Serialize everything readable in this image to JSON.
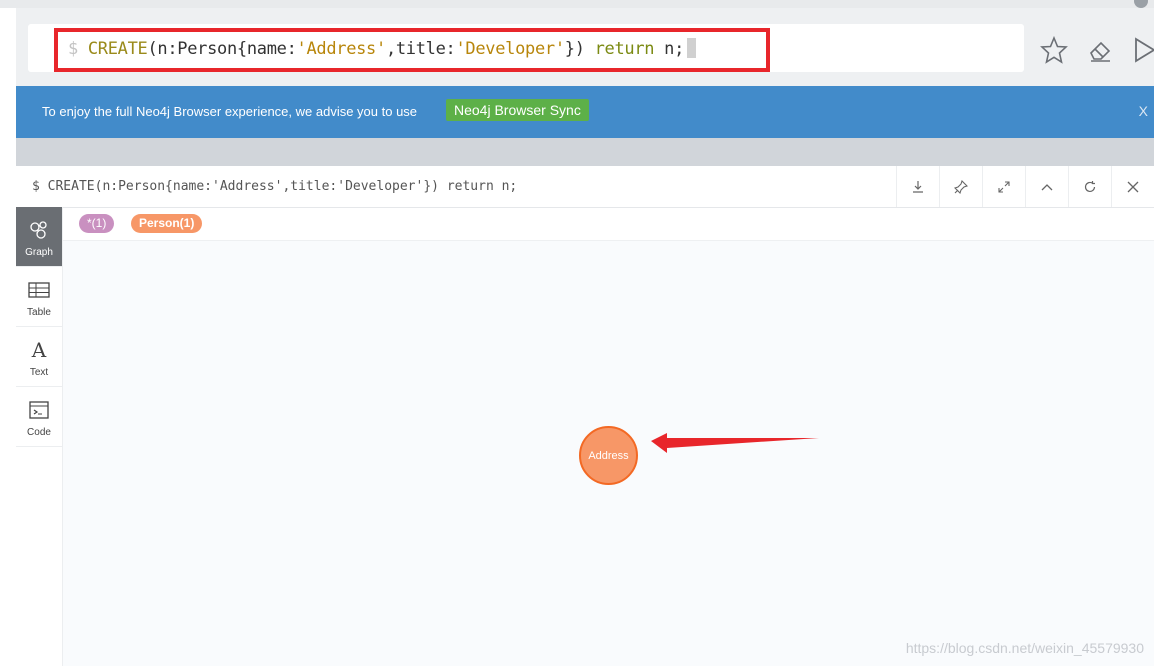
{
  "editor": {
    "prompt": "$",
    "tokens": [
      {
        "text": "CREATE",
        "cls": "kw"
      },
      {
        "text": "(n:Person{name:",
        "cls": ""
      },
      {
        "text": "'Address'",
        "cls": "str"
      },
      {
        "text": ",title:",
        "cls": ""
      },
      {
        "text": "'Developer'",
        "cls": "str"
      },
      {
        "text": "}) ",
        "cls": ""
      },
      {
        "text": "return",
        "cls": "ret"
      },
      {
        "text": " n;",
        "cls": ""
      }
    ],
    "icons": [
      "star-icon",
      "eraser-icon",
      "run-icon"
    ]
  },
  "banner": {
    "message": "To enjoy the full Neo4j Browser experience, we advise you to use",
    "sync_label": "Neo4j Browser Sync",
    "close_label": "X",
    "color": "#428bca",
    "sync_color": "#5db048"
  },
  "frame": {
    "title": "$ CREATE(n:Person{name:'Address',title:'Developer'}) return n;",
    "tools": [
      "download-icon",
      "pin-icon",
      "expand-icon",
      "collapse-icon",
      "refresh-icon",
      "close-icon"
    ]
  },
  "sidebar": {
    "items": [
      {
        "label": "Graph",
        "icon": "graph-icon",
        "active": true
      },
      {
        "label": "Table",
        "icon": "table-icon",
        "active": false
      },
      {
        "label": "Text",
        "icon": "text-icon",
        "active": false
      },
      {
        "label": "Code",
        "icon": "code-icon",
        "active": false
      }
    ]
  },
  "legend": {
    "all_label": "*(1)",
    "person_label": "Person(1)",
    "all_color": "#c990c0",
    "person_color": "#f79767"
  },
  "graph": {
    "node_label": "Address",
    "node_color": "#f79767"
  },
  "watermark": "https://blog.csdn.net/weixin_45579930"
}
